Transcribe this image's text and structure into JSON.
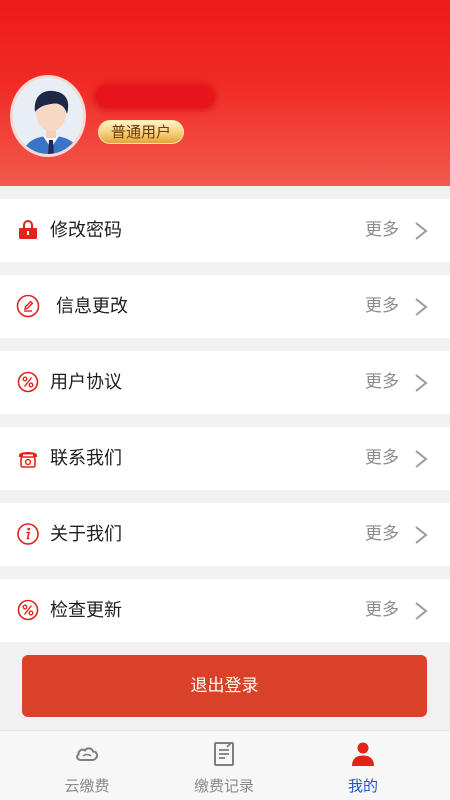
{
  "profile": {
    "username": "",
    "badge": "普通用户",
    "avatar_icon": "user-avatar-illustration"
  },
  "menu": [
    {
      "label": "修改密码",
      "more": "更多",
      "icon": "lock-icon"
    },
    {
      "label": "信息更改",
      "more": "更多",
      "icon": "edit-icon"
    },
    {
      "label": "用户协议",
      "more": "更多",
      "icon": "percent-icon"
    },
    {
      "label": "联系我们",
      "more": "更多",
      "icon": "phone-icon"
    },
    {
      "label": "关于我们",
      "more": "更多",
      "icon": "info-icon"
    },
    {
      "label": "检查更新",
      "more": "更多",
      "icon": "percent-icon"
    }
  ],
  "logout": {
    "label": "退出登录"
  },
  "tabs": [
    {
      "label": "云缴费",
      "icon": "cloud-icon",
      "active": false
    },
    {
      "label": "缴费记录",
      "icon": "record-icon",
      "active": false
    },
    {
      "label": "我的",
      "icon": "user-icon",
      "active": true
    }
  ],
  "colors": {
    "header_top": "#ee1b1b",
    "header_bottom": "#f25a4e",
    "icon_red": "#e2231a",
    "logout_bg": "#d94128",
    "tab_active": "#1f56c8",
    "tab_inactive": "#8a8a8a"
  }
}
